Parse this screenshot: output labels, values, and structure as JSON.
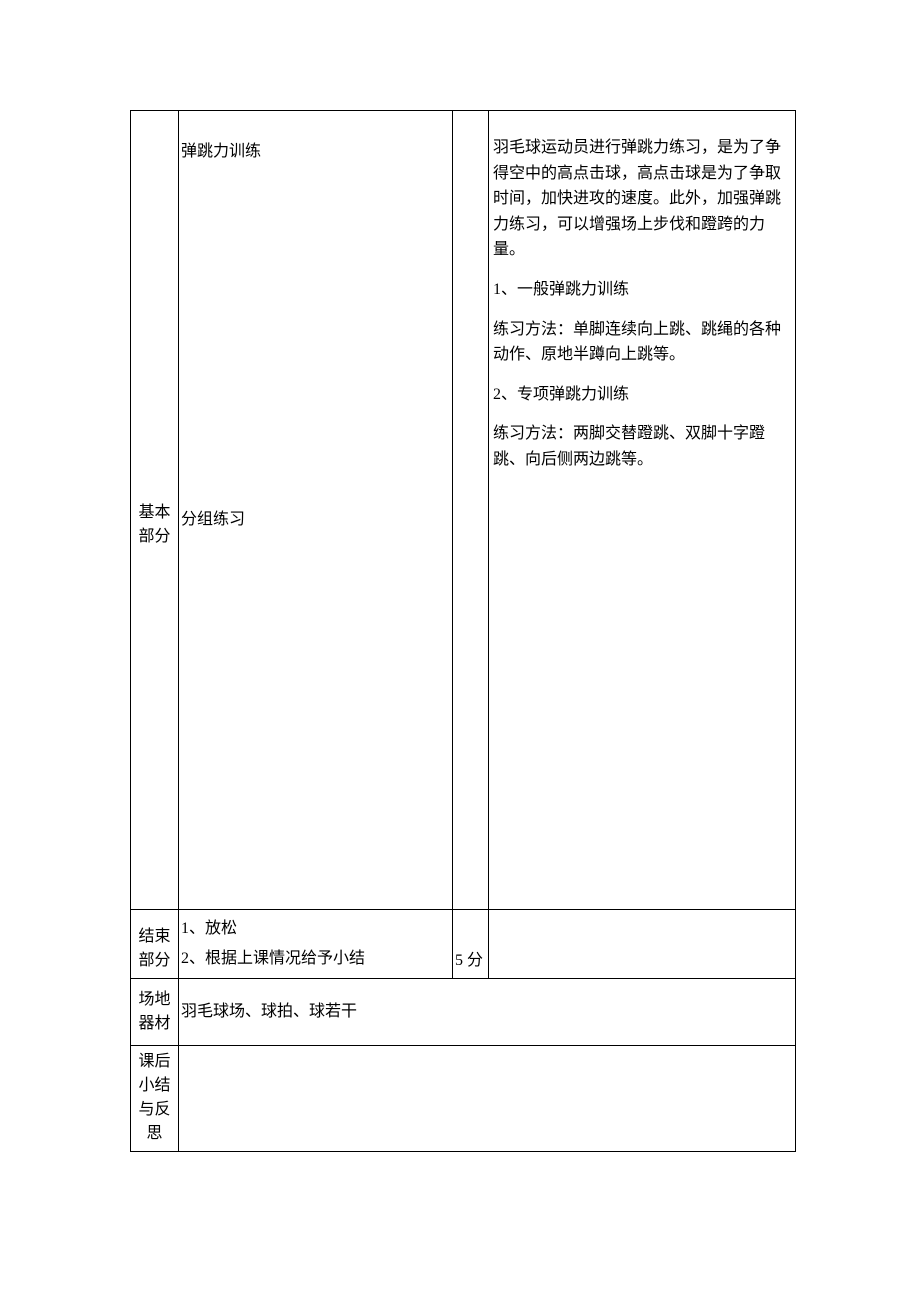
{
  "sections": {
    "basic": {
      "label": "基本部分",
      "content_top": "弹跳力训练",
      "content_mid": "分组练习",
      "notes_intro": "羽毛球运动员进行弹跳力练习，是为了争得空中的高点击球，高点击球是为了争取时间，加快进攻的速度。此外，加强弹跳力练习，可以增强场上步伐和蹬跨的力量。",
      "notes_item1_title": "1、一般弹跳力训练",
      "notes_item1_body": "练习方法：单脚连续向上跳、跳绳的各种动作、原地半蹲向上跳等。",
      "notes_item2_title": "2、专项弹跳力训练",
      "notes_item2_body": "练习方法：两脚交替蹬跳、双脚十字蹬跳、向后侧两边跳等。"
    },
    "end": {
      "label": "结束部分",
      "line1": "1、放松",
      "line2": "2、根据上课情况给予小结",
      "time": "5 分"
    },
    "equipment": {
      "label": "场地器材",
      "content": "羽毛球场、球拍、球若干"
    },
    "reflection": {
      "label": "课后小结与反思",
      "content": ""
    }
  }
}
